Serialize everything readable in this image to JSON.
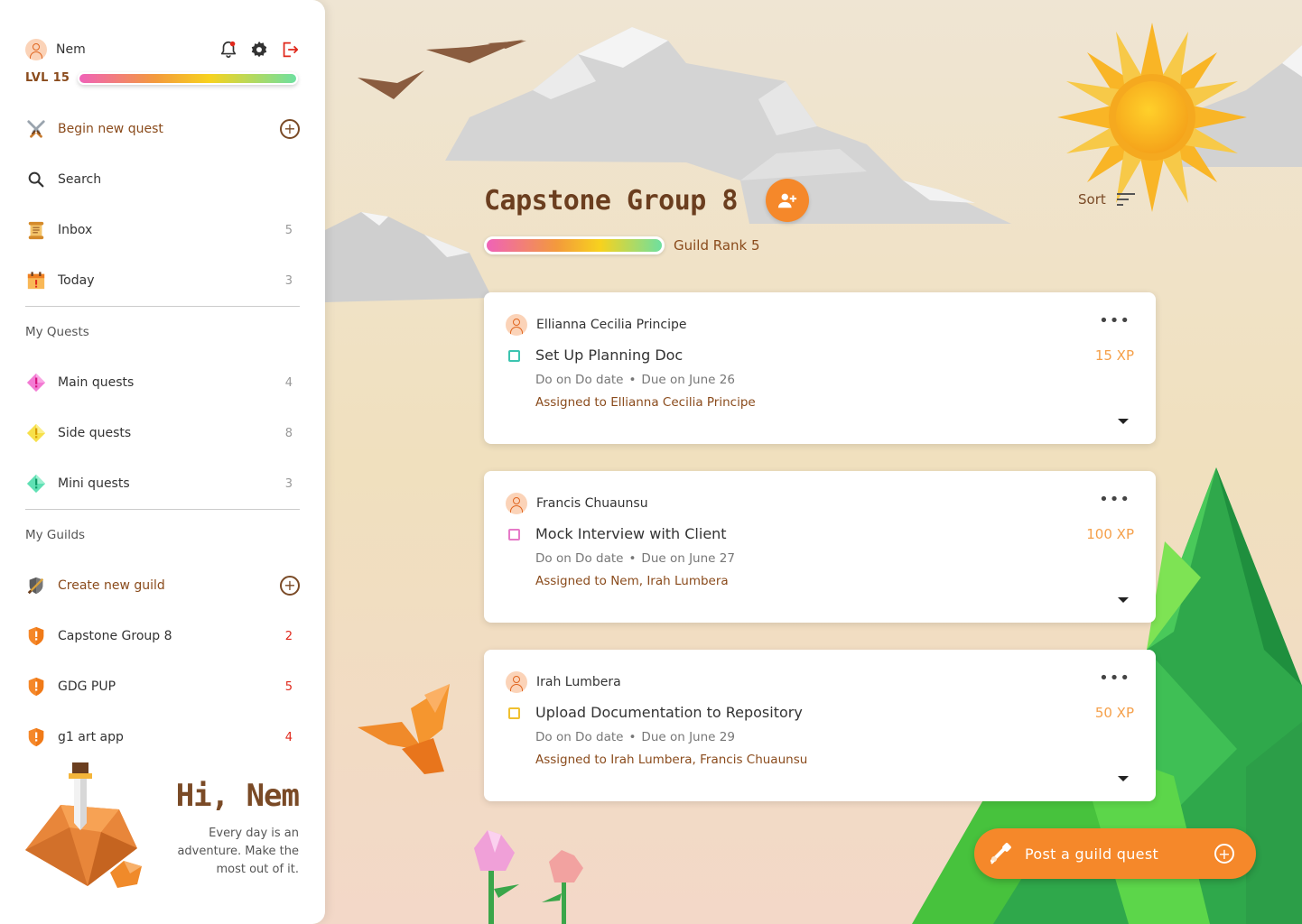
{
  "user": {
    "name": "Nem",
    "level": "LVL 15",
    "xp_progress": 1.0
  },
  "nav": [
    {
      "label": "Begin new quest",
      "count": "",
      "icon": "swords-icon"
    },
    {
      "label": "Search",
      "count": "",
      "icon": "search-icon"
    },
    {
      "label": "Inbox",
      "count": "5",
      "icon": "scroll-icon"
    },
    {
      "label": "Today",
      "count": "3",
      "icon": "calendar-icon"
    }
  ],
  "quests_section": "My Quests",
  "quests": [
    {
      "label": "Main quests",
      "count": "4",
      "color": "#f37ad3"
    },
    {
      "label": "Side quests",
      "count": "8",
      "color": "#f7e04a"
    },
    {
      "label": "Mini quests",
      "count": "3",
      "color": "#5fe0b4"
    }
  ],
  "guilds_section": "My Guilds",
  "create_guild": "Create new guild",
  "guilds": [
    {
      "label": "Capstone Group 8",
      "count": "2"
    },
    {
      "label": "GDG PUP",
      "count": "5"
    },
    {
      "label": "g1 art app",
      "count": "4"
    }
  ],
  "greeting": {
    "title": "Hi, Nem",
    "message": "Every day is an adventure. Make the most out of it."
  },
  "guild": {
    "title": "Capstone Group 8",
    "rank": "Guild Rank 5",
    "rank_progress": 1.0
  },
  "sort_label": "Sort",
  "cards": [
    {
      "author": "Ellianna Cecilia Principe",
      "title": "Set Up Planning Doc",
      "xp": "15 XP",
      "do": "Do on Do date",
      "due": "Due on June 26",
      "assigned": "Assigned to Ellianna Cecilia Principe",
      "checkbox_color": "#3cc4b0"
    },
    {
      "author": "Francis Chuaunsu",
      "title": "Mock Interview with Client",
      "xp": "100 XP",
      "do": "Do on Do date",
      "due": "Due on June 27",
      "assigned": "Assigned to Nem, Irah Lumbera",
      "checkbox_color": "#e67ac8"
    },
    {
      "author": "Irah Lumbera",
      "title": "Upload Documentation to Repository",
      "xp": "50 XP",
      "do": "Do on Do date",
      "due": "Due on June 29",
      "assigned": "Assigned to Irah Lumbera, Francis Chuaunsu",
      "checkbox_color": "#f0c030"
    }
  ],
  "fab_label": "Post a guild quest",
  "colors": {
    "accent": "#f5882a",
    "brown": "#8a4b1c",
    "alert_red": "#e0281b"
  }
}
